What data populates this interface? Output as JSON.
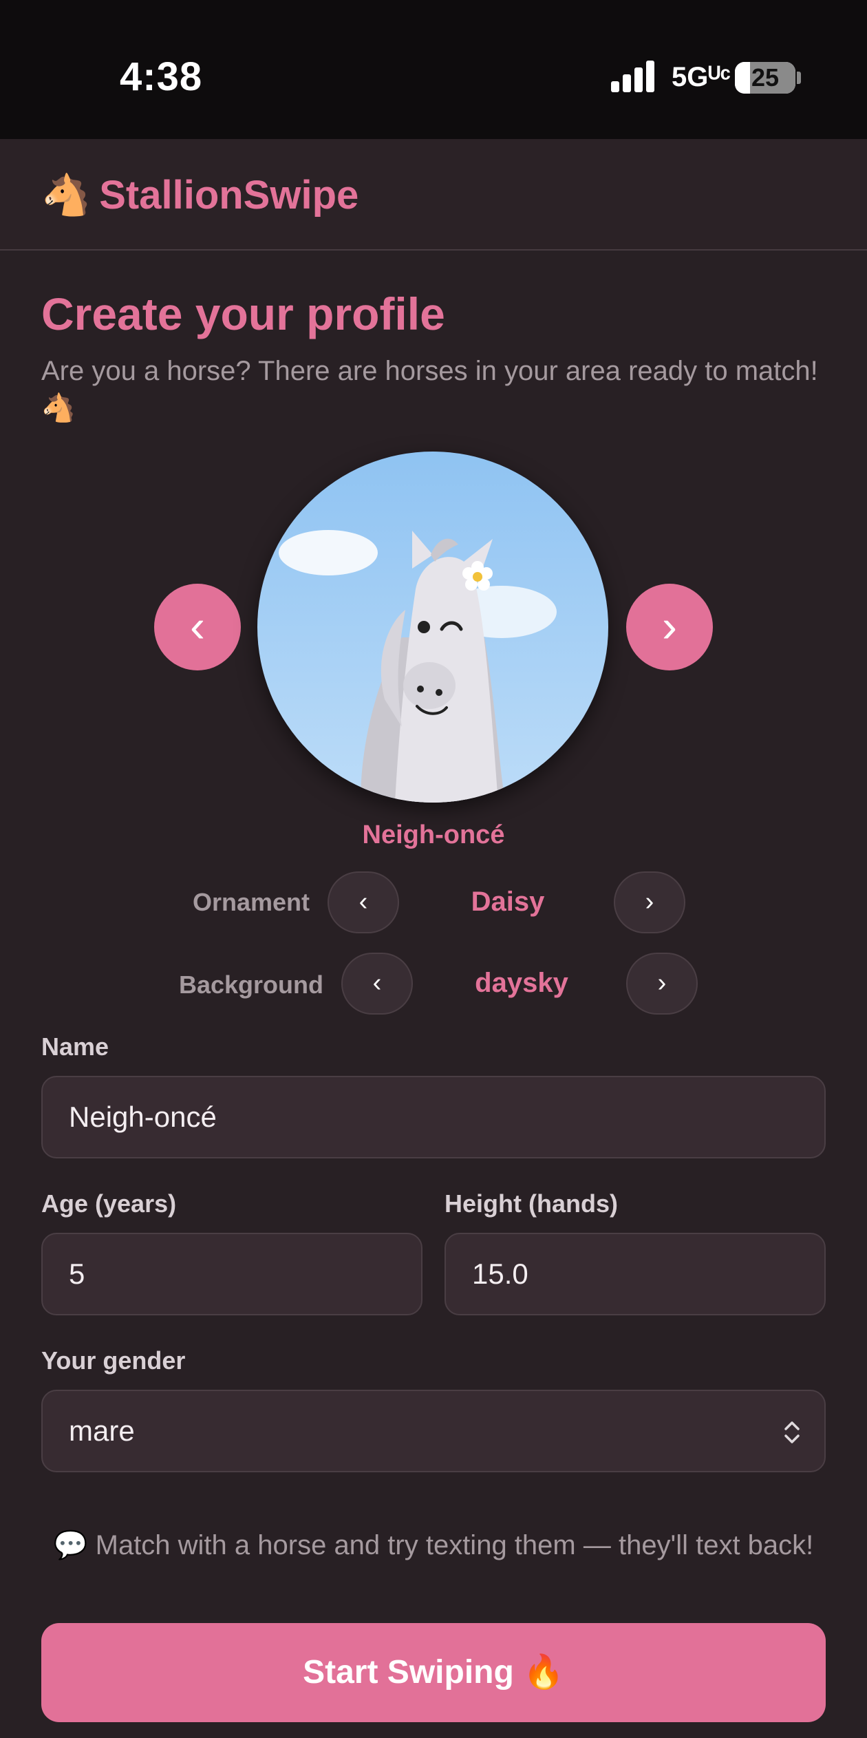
{
  "status_bar": {
    "time": "4:38",
    "network": "5Gᵁᶜ",
    "battery": "25",
    "battery_level": 0.25
  },
  "app": {
    "brand_emoji": "🐴",
    "brand_name": "StallionSwipe"
  },
  "page": {
    "title": "Create your profile",
    "subtitle": "Are you a horse? There are horses in your area ready to match! 🐴"
  },
  "avatar": {
    "prev_label": "‹",
    "next_label": "›",
    "name": "Neigh-oncé",
    "colors": {
      "sky_top": "#8fc3f2",
      "sky_bottom": "#bcdcf8",
      "horse": "#e6e4ea"
    }
  },
  "customize": {
    "ornament": {
      "label": "Ornament",
      "value": "Daisy",
      "prev": "‹",
      "next": "›"
    },
    "background": {
      "label": "Background",
      "value": "daysky",
      "prev": "‹",
      "next": "›"
    }
  },
  "form": {
    "name": {
      "label": "Name",
      "value": "Neigh-oncé"
    },
    "age": {
      "label": "Age (years)",
      "value": "5"
    },
    "height": {
      "label": "Height (hands)",
      "value": "15.0"
    },
    "gender": {
      "label": "Your gender",
      "value": "mare"
    }
  },
  "hint": "💬 Match with a horse and try texting them — they'll text back!",
  "cta": {
    "label": "Start Swiping 🔥"
  },
  "theme": {
    "accent": "#e27198",
    "background": "#282024",
    "field": "#372b31"
  }
}
